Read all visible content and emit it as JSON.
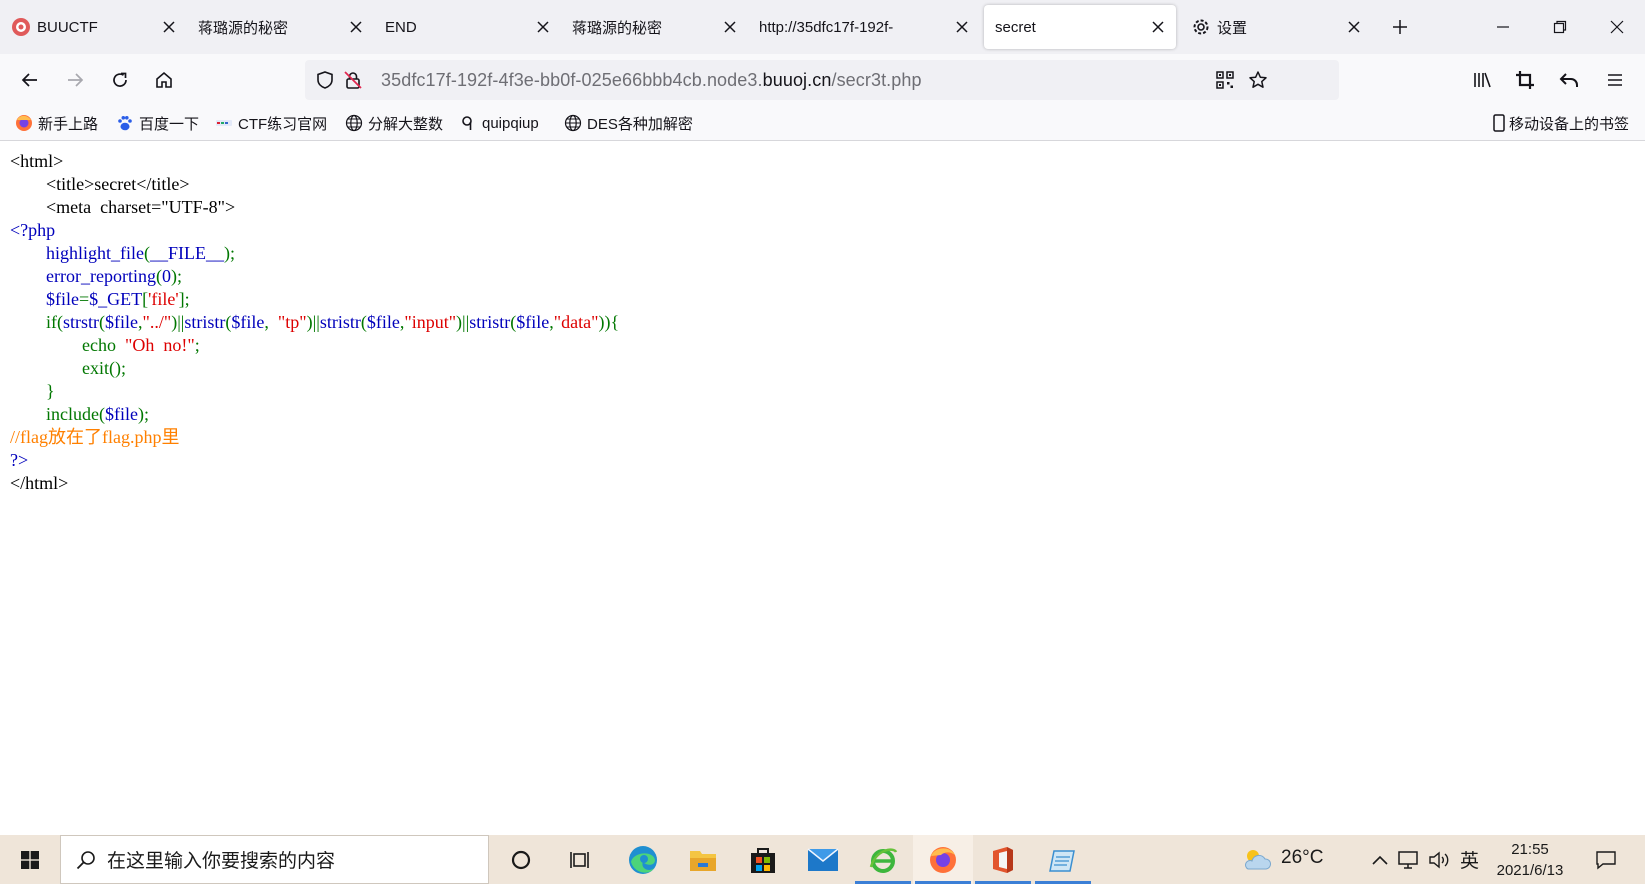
{
  "tabs": [
    {
      "label": "BUUCTF",
      "icon": "buuctf-logo-icon"
    },
    {
      "label": "蒋璐源的秘密"
    },
    {
      "label": "END"
    },
    {
      "label": "蒋璐源的秘密"
    },
    {
      "label": "http://35dfc17f-192f-",
      "faded": true
    },
    {
      "label": "secret",
      "selected": true
    },
    {
      "label": "设置",
      "icon": "gear-icon"
    }
  ],
  "url": {
    "prefix": "35dfc17f-192f-4f3e-bb0f-025e66bbb4cb.node3.",
    "domain": "buuoj.cn",
    "path": "/secr3t.php"
  },
  "bookmarks": [
    {
      "label": "新手上路",
      "icon": "firefox-icon"
    },
    {
      "label": "百度一下",
      "icon": "baidu-paw-icon"
    },
    {
      "label": "CTF练习官网",
      "icon": "ctf-logo-icon"
    },
    {
      "label": "分解大整数",
      "icon": "globe-icon"
    },
    {
      "label": "quipqiup",
      "icon": "q-icon"
    },
    {
      "label": "DES各种加解密",
      "icon": "globe-icon"
    }
  ],
  "mobile_bookmarks": "移动设备上的书签",
  "source_lines": [
    [
      {
        "t": "<html>",
        "c": "def"
      }
    ],
    [
      {
        "t": "        <title>secret</title>",
        "c": "def"
      }
    ],
    [
      {
        "t": "        <meta  charset=\"UTF-8\">",
        "c": "def"
      }
    ],
    [
      {
        "t": "<?php",
        "c": "fn"
      }
    ],
    [
      {
        "t": "        highlight_file",
        "c": "fn"
      },
      {
        "t": "(",
        "c": "kw"
      },
      {
        "t": "__FILE__",
        "c": "fn"
      },
      {
        "t": ");",
        "c": "kw"
      }
    ],
    [
      {
        "t": "        error_reporting",
        "c": "fn"
      },
      {
        "t": "(",
        "c": "kw"
      },
      {
        "t": "0",
        "c": "fn"
      },
      {
        "t": ");",
        "c": "kw"
      }
    ],
    [
      {
        "t": "        $file",
        "c": "fn"
      },
      {
        "t": "=",
        "c": "kw"
      },
      {
        "t": "$_GET",
        "c": "fn"
      },
      {
        "t": "[",
        "c": "kw"
      },
      {
        "t": "'file'",
        "c": "str"
      },
      {
        "t": "];",
        "c": "kw"
      }
    ],
    [
      {
        "t": "        if(",
        "c": "kw"
      },
      {
        "t": "strstr",
        "c": "fn"
      },
      {
        "t": "(",
        "c": "kw"
      },
      {
        "t": "$file",
        "c": "fn"
      },
      {
        "t": ",",
        "c": "kw"
      },
      {
        "t": "\"../\"",
        "c": "str"
      },
      {
        "t": ")||",
        "c": "kw"
      },
      {
        "t": "stristr",
        "c": "fn"
      },
      {
        "t": "(",
        "c": "kw"
      },
      {
        "t": "$file",
        "c": "fn"
      },
      {
        "t": ",  ",
        "c": "kw"
      },
      {
        "t": "\"tp\"",
        "c": "str"
      },
      {
        "t": ")||",
        "c": "kw"
      },
      {
        "t": "stristr",
        "c": "fn"
      },
      {
        "t": "(",
        "c": "kw"
      },
      {
        "t": "$file",
        "c": "fn"
      },
      {
        "t": ",",
        "c": "kw"
      },
      {
        "t": "\"input\"",
        "c": "str"
      },
      {
        "t": ")||",
        "c": "kw"
      },
      {
        "t": "stristr",
        "c": "fn"
      },
      {
        "t": "(",
        "c": "kw"
      },
      {
        "t": "$file",
        "c": "fn"
      },
      {
        "t": ",",
        "c": "kw"
      },
      {
        "t": "\"data\"",
        "c": "str"
      },
      {
        "t": ")){",
        "c": "kw"
      }
    ],
    [
      {
        "t": "                echo  ",
        "c": "kw"
      },
      {
        "t": "\"Oh  no!\"",
        "c": "str"
      },
      {
        "t": ";",
        "c": "kw"
      }
    ],
    [
      {
        "t": "                exit",
        "c": "kw"
      },
      {
        "t": "();",
        "c": "kw"
      }
    ],
    [
      {
        "t": "        }",
        "c": "kw"
      }
    ],
    [
      {
        "t": "        include",
        "c": "kw"
      },
      {
        "t": "(",
        "c": "kw"
      },
      {
        "t": "$file",
        "c": "fn"
      },
      {
        "t": ");",
        "c": "kw"
      }
    ],
    [
      {
        "t": "//flag放在了flag.php里",
        "c": "cmt"
      }
    ],
    [
      {
        "t": "?>",
        "c": "fn"
      }
    ],
    [
      {
        "t": "</html>",
        "c": "def"
      }
    ]
  ],
  "taskbar": {
    "search_placeholder": "在这里输入你要搜索的内容",
    "apps": [
      "cortana-circle-icon",
      "task-view-icon",
      "edge-icon",
      "file-explorer-icon",
      "store-icon",
      "mail-icon",
      "ie-icon",
      "firefox-icon",
      "office-icon",
      "notepad-icon"
    ],
    "weather": "26°C",
    "ime": "英",
    "time": "21:55",
    "date": "2021/6/13"
  },
  "colors": {
    "php_default": "#0000bb",
    "php_keyword": "#007700",
    "php_string": "#dd0000",
    "php_comment": "#ff8000",
    "taskbar_accent": "#3b7fd6"
  }
}
